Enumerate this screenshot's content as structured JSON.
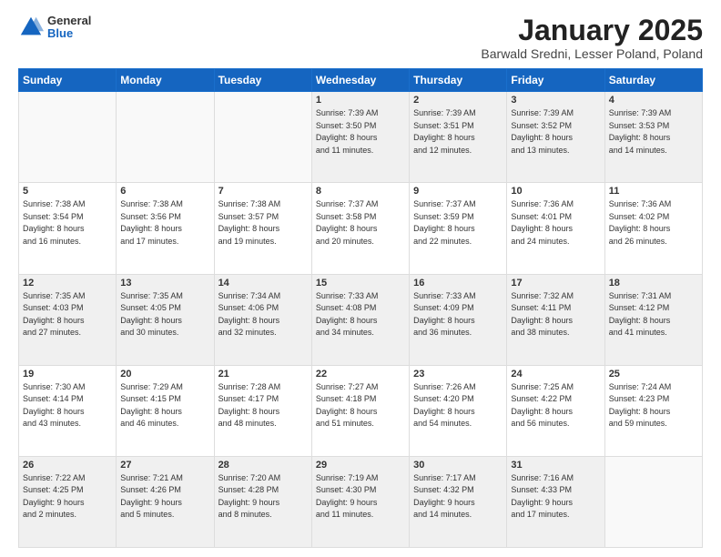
{
  "header": {
    "logo_general": "General",
    "logo_blue": "Blue",
    "month_title": "January 2025",
    "location": "Barwald Sredni, Lesser Poland, Poland"
  },
  "weekdays": [
    "Sunday",
    "Monday",
    "Tuesday",
    "Wednesday",
    "Thursday",
    "Friday",
    "Saturday"
  ],
  "weeks": [
    [
      {
        "day": "",
        "info": ""
      },
      {
        "day": "",
        "info": ""
      },
      {
        "day": "",
        "info": ""
      },
      {
        "day": "1",
        "info": "Sunrise: 7:39 AM\nSunset: 3:50 PM\nDaylight: 8 hours\nand 11 minutes."
      },
      {
        "day": "2",
        "info": "Sunrise: 7:39 AM\nSunset: 3:51 PM\nDaylight: 8 hours\nand 12 minutes."
      },
      {
        "day": "3",
        "info": "Sunrise: 7:39 AM\nSunset: 3:52 PM\nDaylight: 8 hours\nand 13 minutes."
      },
      {
        "day": "4",
        "info": "Sunrise: 7:39 AM\nSunset: 3:53 PM\nDaylight: 8 hours\nand 14 minutes."
      }
    ],
    [
      {
        "day": "5",
        "info": "Sunrise: 7:38 AM\nSunset: 3:54 PM\nDaylight: 8 hours\nand 16 minutes."
      },
      {
        "day": "6",
        "info": "Sunrise: 7:38 AM\nSunset: 3:56 PM\nDaylight: 8 hours\nand 17 minutes."
      },
      {
        "day": "7",
        "info": "Sunrise: 7:38 AM\nSunset: 3:57 PM\nDaylight: 8 hours\nand 19 minutes."
      },
      {
        "day": "8",
        "info": "Sunrise: 7:37 AM\nSunset: 3:58 PM\nDaylight: 8 hours\nand 20 minutes."
      },
      {
        "day": "9",
        "info": "Sunrise: 7:37 AM\nSunset: 3:59 PM\nDaylight: 8 hours\nand 22 minutes."
      },
      {
        "day": "10",
        "info": "Sunrise: 7:36 AM\nSunset: 4:01 PM\nDaylight: 8 hours\nand 24 minutes."
      },
      {
        "day": "11",
        "info": "Sunrise: 7:36 AM\nSunset: 4:02 PM\nDaylight: 8 hours\nand 26 minutes."
      }
    ],
    [
      {
        "day": "12",
        "info": "Sunrise: 7:35 AM\nSunset: 4:03 PM\nDaylight: 8 hours\nand 27 minutes."
      },
      {
        "day": "13",
        "info": "Sunrise: 7:35 AM\nSunset: 4:05 PM\nDaylight: 8 hours\nand 30 minutes."
      },
      {
        "day": "14",
        "info": "Sunrise: 7:34 AM\nSunset: 4:06 PM\nDaylight: 8 hours\nand 32 minutes."
      },
      {
        "day": "15",
        "info": "Sunrise: 7:33 AM\nSunset: 4:08 PM\nDaylight: 8 hours\nand 34 minutes."
      },
      {
        "day": "16",
        "info": "Sunrise: 7:33 AM\nSunset: 4:09 PM\nDaylight: 8 hours\nand 36 minutes."
      },
      {
        "day": "17",
        "info": "Sunrise: 7:32 AM\nSunset: 4:11 PM\nDaylight: 8 hours\nand 38 minutes."
      },
      {
        "day": "18",
        "info": "Sunrise: 7:31 AM\nSunset: 4:12 PM\nDaylight: 8 hours\nand 41 minutes."
      }
    ],
    [
      {
        "day": "19",
        "info": "Sunrise: 7:30 AM\nSunset: 4:14 PM\nDaylight: 8 hours\nand 43 minutes."
      },
      {
        "day": "20",
        "info": "Sunrise: 7:29 AM\nSunset: 4:15 PM\nDaylight: 8 hours\nand 46 minutes."
      },
      {
        "day": "21",
        "info": "Sunrise: 7:28 AM\nSunset: 4:17 PM\nDaylight: 8 hours\nand 48 minutes."
      },
      {
        "day": "22",
        "info": "Sunrise: 7:27 AM\nSunset: 4:18 PM\nDaylight: 8 hours\nand 51 minutes."
      },
      {
        "day": "23",
        "info": "Sunrise: 7:26 AM\nSunset: 4:20 PM\nDaylight: 8 hours\nand 54 minutes."
      },
      {
        "day": "24",
        "info": "Sunrise: 7:25 AM\nSunset: 4:22 PM\nDaylight: 8 hours\nand 56 minutes."
      },
      {
        "day": "25",
        "info": "Sunrise: 7:24 AM\nSunset: 4:23 PM\nDaylight: 8 hours\nand 59 minutes."
      }
    ],
    [
      {
        "day": "26",
        "info": "Sunrise: 7:22 AM\nSunset: 4:25 PM\nDaylight: 9 hours\nand 2 minutes."
      },
      {
        "day": "27",
        "info": "Sunrise: 7:21 AM\nSunset: 4:26 PM\nDaylight: 9 hours\nand 5 minutes."
      },
      {
        "day": "28",
        "info": "Sunrise: 7:20 AM\nSunset: 4:28 PM\nDaylight: 9 hours\nand 8 minutes."
      },
      {
        "day": "29",
        "info": "Sunrise: 7:19 AM\nSunset: 4:30 PM\nDaylight: 9 hours\nand 11 minutes."
      },
      {
        "day": "30",
        "info": "Sunrise: 7:17 AM\nSunset: 4:32 PM\nDaylight: 9 hours\nand 14 minutes."
      },
      {
        "day": "31",
        "info": "Sunrise: 7:16 AM\nSunset: 4:33 PM\nDaylight: 9 hours\nand 17 minutes."
      },
      {
        "day": "",
        "info": ""
      }
    ]
  ]
}
